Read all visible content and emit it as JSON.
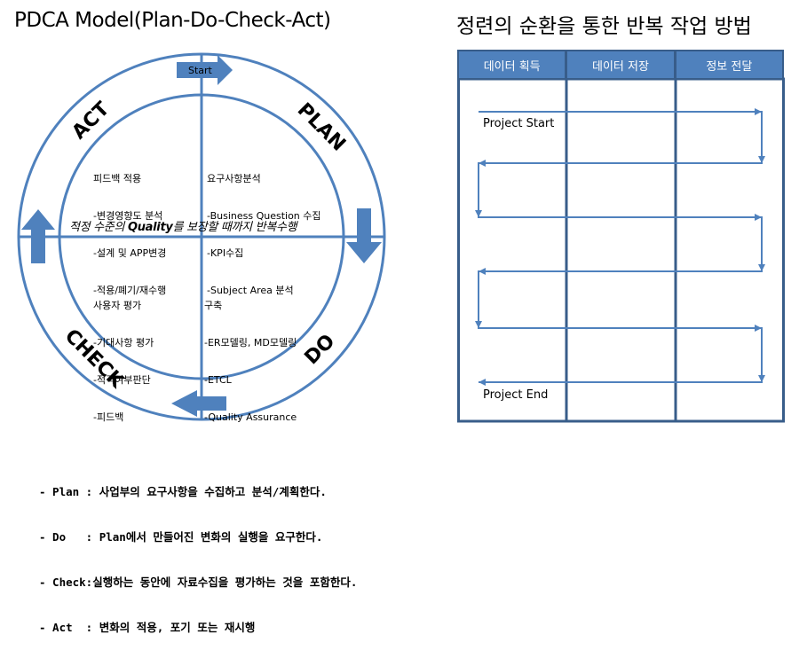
{
  "left_panel": {
    "title": "PDCA Model(Plan-Do-Check-Act)",
    "start_label": "Start",
    "phases": {
      "act": "ACT",
      "plan": "PLAN",
      "do": "DO",
      "check": "CHECK"
    },
    "center_text_prefix": "적정 수준의 ",
    "center_text_bold": "Quality",
    "center_text_suffix": "를 보장할 때까지 반복수행",
    "quadrants": {
      "act": [
        "피드백 적용",
        "-변경영향도 분석",
        "-설계 및 APP변경",
        "-적용/폐기/재수행"
      ],
      "plan": [
        "요구사항분석",
        "-Business Question 수집",
        "-KPI수집",
        "-Subject Area 분석"
      ],
      "check": [
        "사용자 평가",
        "-기대사항 평가",
        "-적격여부판단",
        "-피드백"
      ],
      "do": [
        "구축",
        "-ER모델링, MD모델링",
        "-ETCL",
        "-Quality Assurance"
      ]
    },
    "legend": [
      "- Plan : 사업부의 요구사항을 수집하고 분석/계획한다.",
      "- Do   : Plan에서 만들어진 변화의 실행을 요구한다.",
      "- Check:실행하는 동안에 자료수집을 평가하는 것을 포함한다.",
      "- Act  : 변화의 적용, 포기 또는 재시행"
    ]
  },
  "right_panel": {
    "title": "정련의 순환을 통한 반복 작업 방법",
    "columns": [
      "데이터 획득",
      "데이터 저장",
      "정보 전달"
    ],
    "start_label": "Project Start",
    "end_label": "Project End"
  },
  "colors": {
    "primary_blue": "#4f81bd",
    "dark_blue": "#385d8a"
  }
}
